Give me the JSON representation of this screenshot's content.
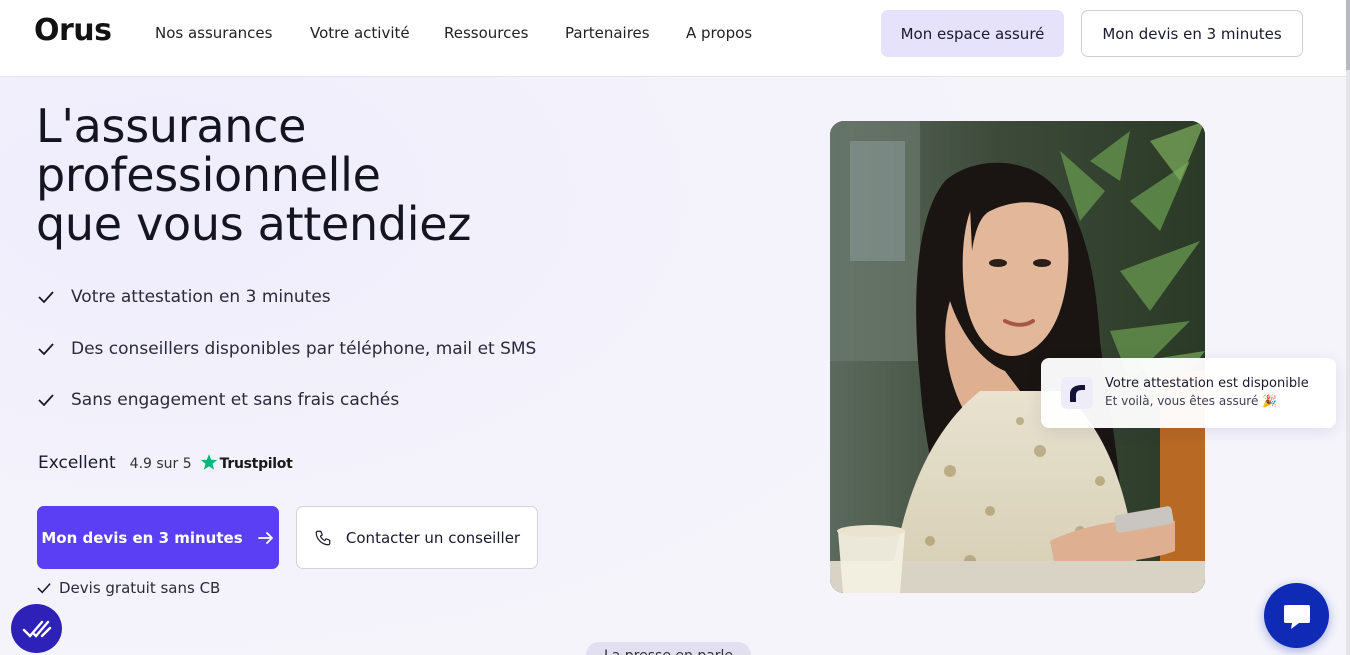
{
  "header": {
    "logo": "Orus",
    "nav": [
      {
        "label": "Nos assurances"
      },
      {
        "label": "Votre activité"
      },
      {
        "label": "Ressources"
      },
      {
        "label": "Partenaires"
      },
      {
        "label": "A propos"
      }
    ],
    "account_button": "Mon espace assuré",
    "quote_button": "Mon devis en 3 minutes"
  },
  "hero": {
    "title_lines": [
      "L'assurance",
      "professionnelle",
      "que vous attendiez"
    ],
    "features": [
      {
        "label": "Votre attestation en 3 minutes",
        "icon": "check-icon"
      },
      {
        "label": "Des conseillers disponibles par téléphone, mail et SMS",
        "icon": "check-icon"
      },
      {
        "label": "Sans engagement et sans frais cachés",
        "icon": "check-icon"
      }
    ],
    "rating": {
      "label": "Excellent",
      "score": "4.9 sur 5",
      "provider": "Trustpilot",
      "provider_icon": "star-icon",
      "provider_color": "#00b67a"
    },
    "primary_cta": "Mon devis en 3 minutes",
    "secondary_cta": "Contacter un conseiller",
    "free_quote_note": "Devis gratuit sans CB"
  },
  "toast": {
    "title": "Votre attestation est disponible",
    "subtitle": "Et voilà, vous êtes assuré 🎉",
    "icon": "orus-logo-icon"
  },
  "press_pill": "La presse en parle",
  "colors": {
    "primary": "#5b3ff5",
    "account_button_bg": "#e6e2fc",
    "chat_bubble": "#0f2bb5",
    "badge": "#2e21b8"
  }
}
